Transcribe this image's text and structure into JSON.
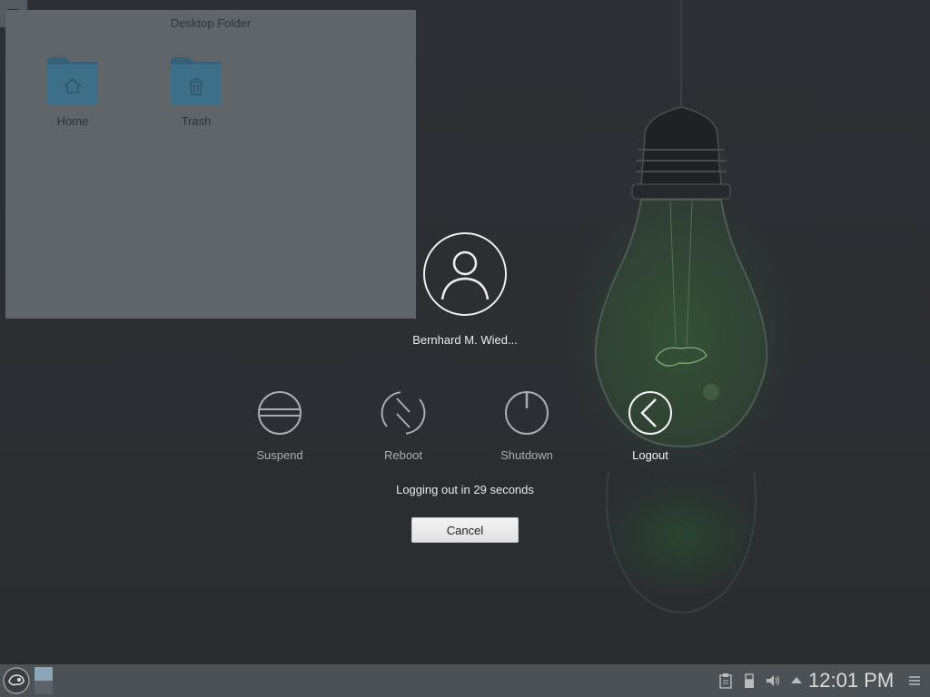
{
  "desktop_folder": {
    "title": "Desktop Folder",
    "items": [
      {
        "label": "Home",
        "icon": "home-folder-icon"
      },
      {
        "label": "Trash",
        "icon": "trash-folder-icon"
      }
    ]
  },
  "logout_screen": {
    "username": "Bernhard M. Wied...",
    "actions": [
      {
        "label": "Suspend",
        "icon": "suspend-icon"
      },
      {
        "label": "Reboot",
        "icon": "reboot-icon"
      },
      {
        "label": "Shutdown",
        "icon": "shutdown-icon"
      },
      {
        "label": "Logout",
        "icon": "logout-icon",
        "selected": true
      }
    ],
    "countdown_text": "Logging out in 29 seconds",
    "cancel_label": "Cancel"
  },
  "panel": {
    "clock": "12:01 PM",
    "tray_icons": [
      "clipboard-icon",
      "usb-device-icon",
      "volume-icon",
      "expand-tray-icon",
      "panel-menu-icon"
    ]
  },
  "colors": {
    "folder_icon": "#3d6f88",
    "panel": "#4c5155",
    "pager_active": "#8aa6b8"
  }
}
